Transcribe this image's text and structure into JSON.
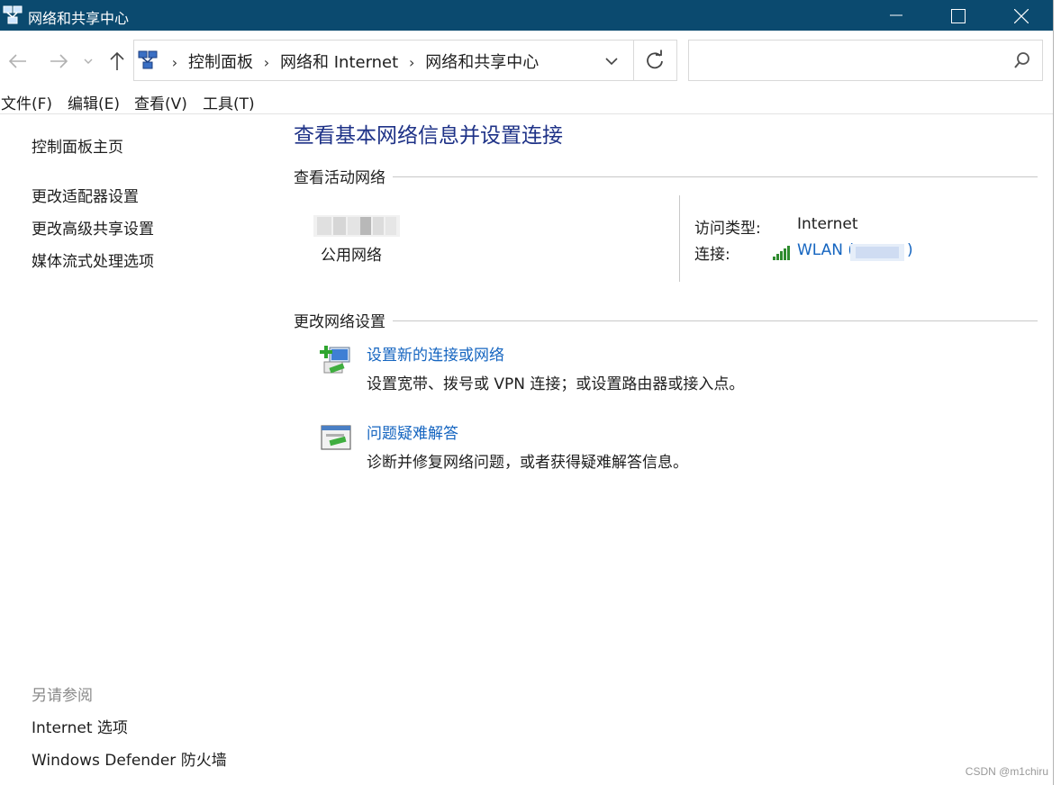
{
  "window": {
    "title": "网络和共享中心"
  },
  "breadcrumb": {
    "items": [
      "控制面板",
      "网络和 Internet",
      "网络和共享中心"
    ]
  },
  "menu": {
    "items": [
      "文件(F)",
      "编辑(E)",
      "查看(V)",
      "工具(T)"
    ]
  },
  "sidebar": {
    "links": [
      "控制面板主页",
      "更改适配器设置",
      "更改高级共享设置",
      "媒体流式处理选项"
    ],
    "see_also_heading": "另请参阅",
    "see_also_links": [
      "Internet 选项",
      "Windows Defender 防火墙"
    ]
  },
  "main": {
    "title": "查看基本网络信息并设置连接",
    "active_networks_heading": "查看活动网络",
    "network": {
      "type": "公用网络",
      "access_type_label": "访问类型:",
      "access_type_value": "Internet",
      "connections_label": "连接:",
      "connection_name": "WLAN (",
      "connection_close": ")"
    },
    "change_settings_heading": "更改网络设置",
    "tasks": [
      {
        "link": "设置新的连接或网络",
        "description": "设置宽带、拨号或 VPN 连接；或设置路由器或接入点。",
        "icon": "new-connection-icon"
      },
      {
        "link": "问题疑难解答",
        "description": "诊断并修复网络问题，或者获得疑难解答信息。",
        "icon": "troubleshoot-icon"
      }
    ]
  },
  "search": {
    "placeholder": ""
  },
  "watermark": "CSDN @m1chiru",
  "colors": {
    "titlebar": "#0b4a6f",
    "link": "#1565c0",
    "page_title": "#1e3287"
  }
}
